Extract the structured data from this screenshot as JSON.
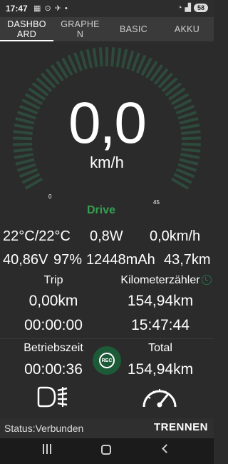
{
  "statusbar": {
    "time": "17:47",
    "icons": "▦ ⊙ ✈ •",
    "battery": "58"
  },
  "tabs": [
    {
      "label": "DASHBOARD",
      "display": "DASHBO\nARD",
      "active": true
    },
    {
      "label": "GRAPHEN",
      "display": "GRAPHE\nN",
      "active": false
    },
    {
      "label": "BASIC",
      "display": "BASIC",
      "active": false
    },
    {
      "label": "AKKU",
      "display": "AKKU",
      "active": false
    }
  ],
  "gauge": {
    "speed": "0,0",
    "unit": "km/h",
    "min": "0",
    "max": "45",
    "mode": "Drive",
    "level": 0
  },
  "metrics": {
    "temperature": "22°C/22°C",
    "power": "0,8W",
    "avg_speed": "0,0km/h",
    "voltage": "40,86V",
    "battery_percent": "97%",
    "capacity": "12448mAh",
    "range": "43,7km"
  },
  "trip": {
    "label": "Trip",
    "distance": "0,00km",
    "duration": "00:00:00"
  },
  "odometer": {
    "label": "Kilometerzähler",
    "distance": "154,94km",
    "duration": "15:47:44"
  },
  "runtime": {
    "label": "Betriebszeit",
    "value": "00:00:36"
  },
  "total": {
    "label": "Total",
    "value": "154,94km"
  },
  "record_button": {
    "label": "REC"
  },
  "bottom": {
    "status": "Status:Verbunden",
    "disconnect": "TRENNEN"
  },
  "colors": {
    "accent": "#35a050",
    "gauge_track": "#2d4a3c",
    "background": "#2b2b2b"
  }
}
